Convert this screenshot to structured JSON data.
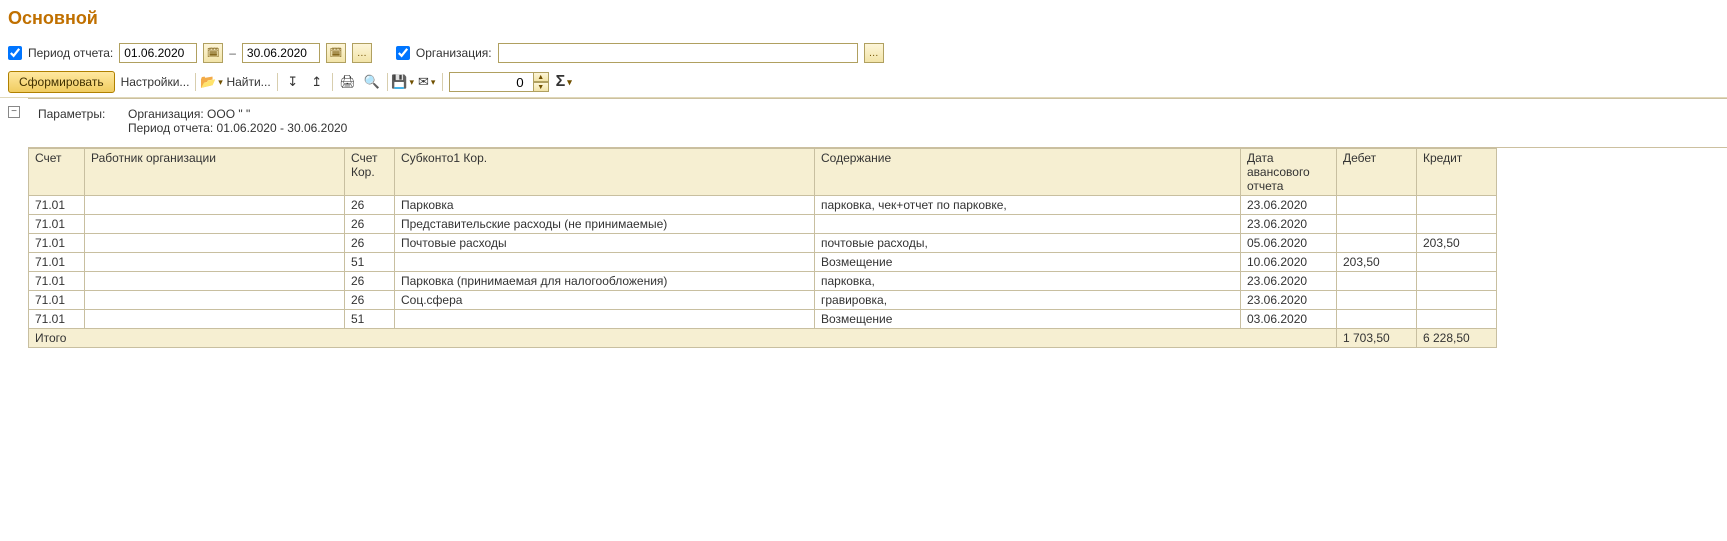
{
  "title": "Основной",
  "filters": {
    "period_checkbox_checked": true,
    "period_label": "Период отчета:",
    "date_from": "01.06.2020",
    "date_to": "30.06.2020",
    "org_checkbox_checked": true,
    "org_label": "Организация:",
    "org_value": ""
  },
  "toolbar": {
    "form_button": "Сформировать",
    "settings": "Настройки...",
    "find": "Найти...",
    "num_value": "0",
    "sigma": "Σ"
  },
  "params": {
    "label": "Параметры:",
    "org_line": "Организация: ООО \"                                   \"",
    "period_line": "Период отчета: 01.06.2020 - 30.06.2020"
  },
  "columns": {
    "acct": "Счет",
    "emp": "Работник организации",
    "acctk": "Счет Кор.",
    "sub": "Субконто1 Кор.",
    "cont": "Содержание",
    "date": "Дата авансового отчета",
    "deb": "Дебет",
    "cred": "Кредит"
  },
  "rows": [
    {
      "acct": "71.01",
      "emp": "",
      "acctk": "26",
      "sub": "Парковка",
      "cont": "парковка, чек+отчет по парковке,",
      "date": "23.06.2020",
      "deb": "",
      "cred": ""
    },
    {
      "acct": "71.01",
      "emp": "",
      "acctk": "26",
      "sub": "Представительские расходы (не принимаемые)",
      "cont": "",
      "date": "23.06.2020",
      "deb": "",
      "cred": ""
    },
    {
      "acct": "71.01",
      "emp": "",
      "acctk": "26",
      "sub": "Почтовые расходы",
      "cont": "почтовые расходы,",
      "date": "05.06.2020",
      "deb": "",
      "cred": "203,50"
    },
    {
      "acct": "71.01",
      "emp": "",
      "acctk": "51",
      "sub": "",
      "cont": "Возмещение",
      "date": "10.06.2020",
      "deb": "203,50",
      "cred": ""
    },
    {
      "acct": "71.01",
      "emp": "",
      "acctk": "26",
      "sub": "Парковка (принимаемая для налогообложения)",
      "cont": "парковка,",
      "date": "23.06.2020",
      "deb": "",
      "cred": ""
    },
    {
      "acct": "71.01",
      "emp": "",
      "acctk": "26",
      "sub": "Соц.сфера",
      "cont": "гравировка,",
      "date": "23.06.2020",
      "deb": "",
      "cred": ""
    },
    {
      "acct": "71.01",
      "emp": "",
      "acctk": "51",
      "sub": "",
      "cont": "Возмещение",
      "date": "03.06.2020",
      "deb": "",
      "cred": ""
    }
  ],
  "total": {
    "label": "Итого",
    "deb": "1 703,50",
    "cred": "6 228,50"
  }
}
